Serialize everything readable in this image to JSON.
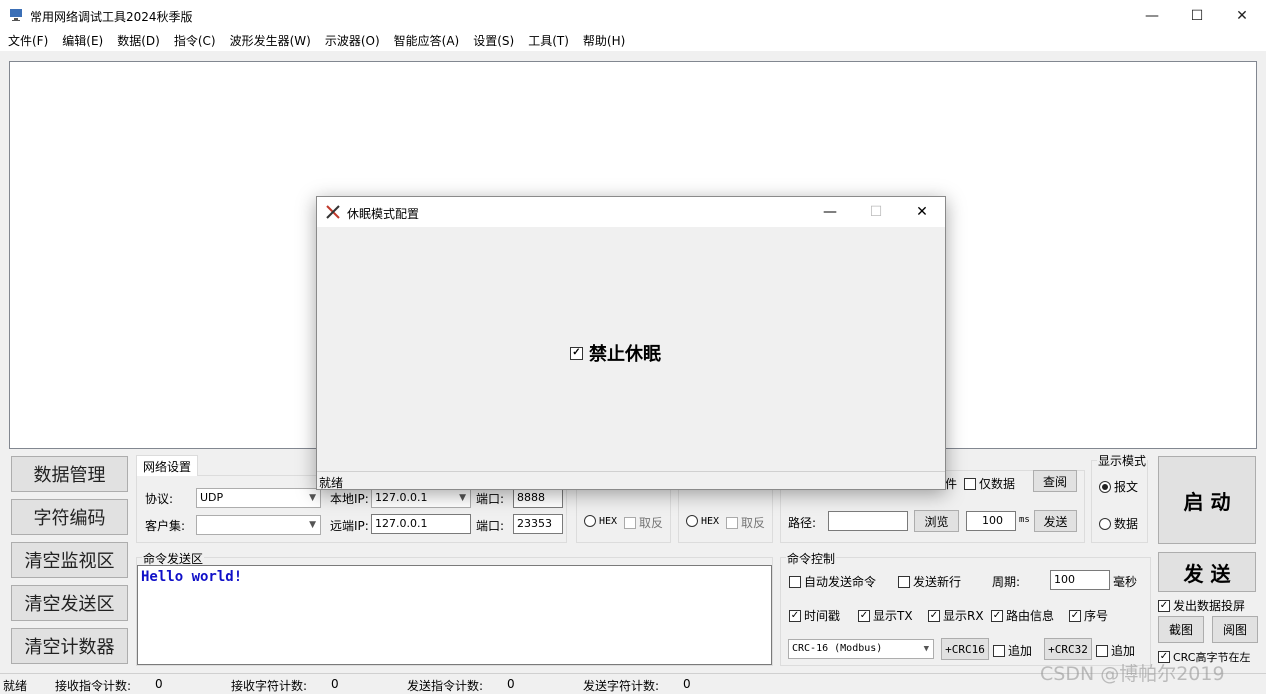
{
  "app": {
    "title": "常用网络调试工具2024秋季版",
    "min": "—",
    "max": "☐",
    "close": "✕"
  },
  "menu": [
    "文件(F)",
    "编辑(E)",
    "数据(D)",
    "指令(C)",
    "波形发生器(W)",
    "示波器(O)",
    "智能应答(A)",
    "设置(S)",
    "工具(T)",
    "帮助(H)"
  ],
  "left_buttons": [
    "数据管理",
    "字符编码",
    "清空监视区",
    "清空发送区",
    "清空计数器"
  ],
  "network": {
    "tab": "网络设置",
    "protocol_label": "协议:",
    "protocol_value": "UDP",
    "client_label": "客户集:",
    "client_value": "",
    "local_ip_label": "本地IP:",
    "local_ip": "127.0.0.1",
    "remote_ip_label": "远端IP:",
    "remote_ip": "127.0.0.1",
    "port_label": "端口:",
    "local_port": "8888",
    "remote_port": "23353"
  },
  "rx": {
    "hex": "HEX",
    "invert": "取反"
  },
  "tx": {
    "hex": "HEX",
    "invert": "取反"
  },
  "file": {
    "tail_text": "件",
    "only_data": "仅数据",
    "view": "查阅",
    "path_label": "路径:",
    "path_value": "",
    "browse": "浏览",
    "interval": "100",
    "ms": "ms",
    "send": "发送"
  },
  "display": {
    "title": "显示模式",
    "opt_message": "报文",
    "opt_data": "数据"
  },
  "command_send": {
    "title": "命令发送区",
    "content": "Hello world!"
  },
  "command_ctrl": {
    "title": "命令控制",
    "auto_send": "自动发送命令",
    "send_newline": "发送新行",
    "period_label": "周期:",
    "period_value": "100",
    "period_unit": "毫秒",
    "timestamp": "时间戳",
    "show_tx": "显示TX",
    "show_rx": "显示RX",
    "route_info": "路由信息",
    "seq": "序号",
    "crc_select": "CRC-16 (Modbus)",
    "add_crc16": "+CRC16",
    "append1": "追加",
    "add_crc32": "+CRC32",
    "append2": "追加"
  },
  "right": {
    "start": "启 动",
    "send": "发 送",
    "send_screen": "发出数据投屏",
    "screenshot": "截图",
    "read_image": "阅图",
    "crc_high_left": "CRC高字节在左"
  },
  "status": {
    "ready": "就绪",
    "rx_cmd_label": "接收指令计数:",
    "rx_cmd": "0",
    "rx_char_label": "接收字符计数:",
    "rx_char": "0",
    "tx_cmd_label": "发送指令计数:",
    "tx_cmd": "0",
    "tx_char_label": "发送字符计数:",
    "tx_char": "0"
  },
  "watermark": "CSDN @博帕尔2019",
  "dialog": {
    "title": "休眠模式配置",
    "checkbox_label": "禁止休眠",
    "status": "就绪"
  }
}
